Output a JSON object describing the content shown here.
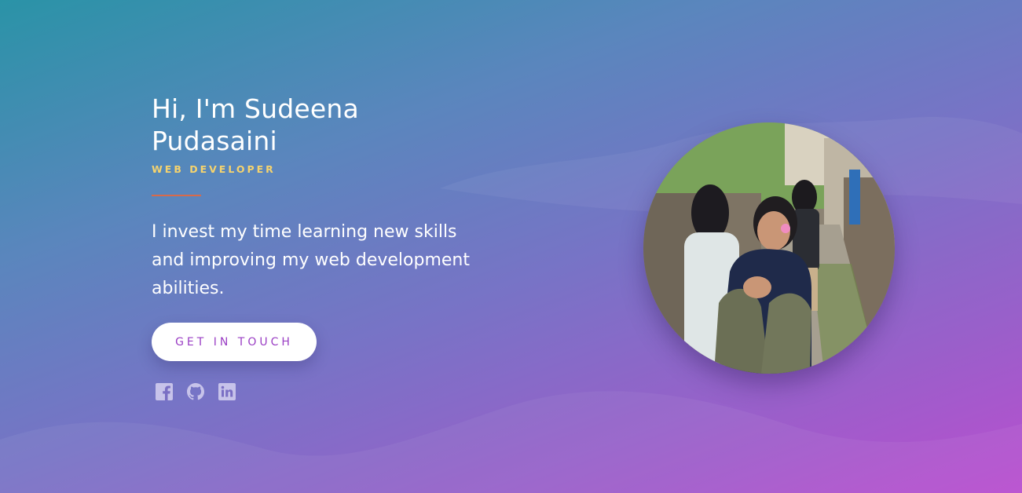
{
  "hero": {
    "title_line1": "Hi, I'm Sudeena",
    "title_line2": "Pudasaini",
    "subtitle": "WEB DEVELOPER",
    "description": "I invest my time learning new skills and improving my web development abilities.",
    "cta_label": "GET IN TOUCH"
  },
  "socials": [
    {
      "name": "Facebook",
      "icon": "facebook-icon"
    },
    {
      "name": "GitHub",
      "icon": "github-icon"
    },
    {
      "name": "LinkedIn",
      "icon": "linkedin-icon"
    }
  ],
  "colors": {
    "accent_subtitle": "#f5d36e",
    "divider": "#d86a4a",
    "cta_text": "#9a3ec4",
    "icon_fill": "#c7c3ea"
  }
}
